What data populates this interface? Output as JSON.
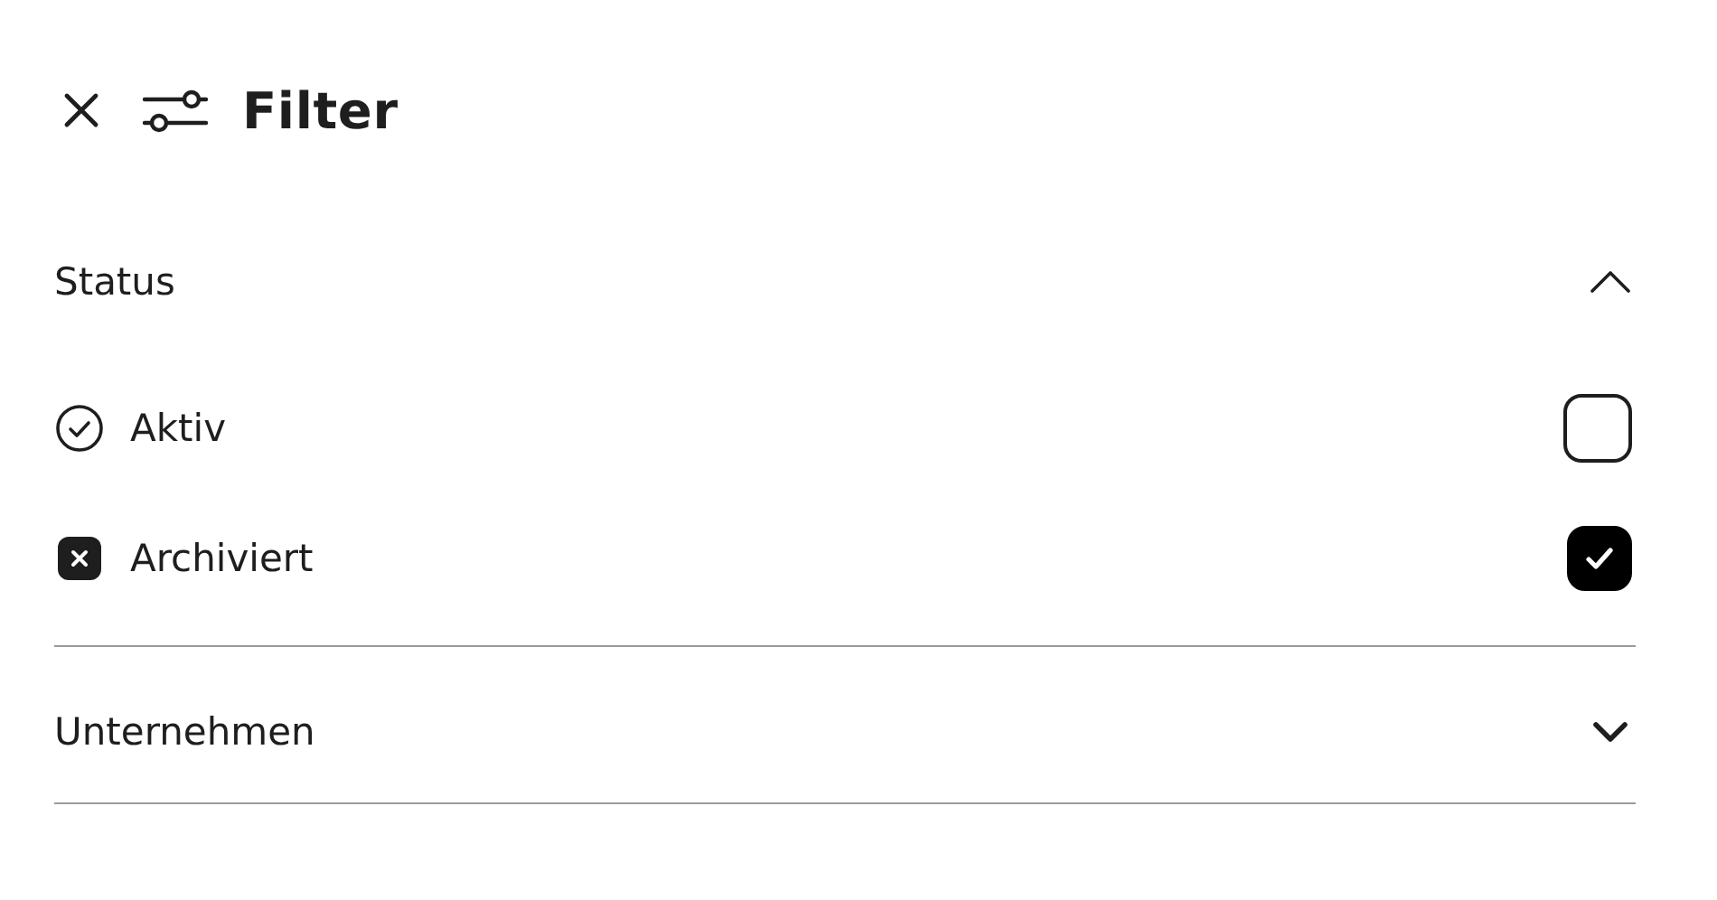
{
  "header": {
    "title": "Filter"
  },
  "sections": [
    {
      "title": "Status",
      "expanded": true,
      "options": [
        {
          "label": "Aktiv",
          "kind": "active",
          "checked": false
        },
        {
          "label": "Archiviert",
          "kind": "archived",
          "checked": true
        }
      ]
    },
    {
      "title": "Unternehmen",
      "expanded": false
    }
  ]
}
